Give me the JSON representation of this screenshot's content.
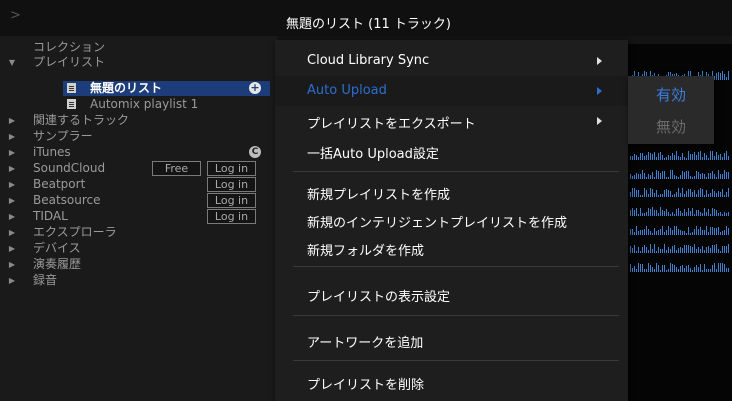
{
  "header": {
    "title": "無題のリスト (11 トラック)"
  },
  "sidebar": {
    "top_chevron": ">",
    "items": [
      {
        "label": "コレクション",
        "arrow": "none"
      },
      {
        "label": "プレイリスト",
        "arrow": "open"
      },
      {
        "label": "無題のリスト",
        "arrow": "none",
        "selected": true
      },
      {
        "label": "Automix playlist 1",
        "arrow": "none"
      },
      {
        "label": "関連するトラック",
        "arrow": "closed"
      },
      {
        "label": "サンプラー",
        "arrow": "closed"
      },
      {
        "label": "iTunes",
        "arrow": "closed"
      },
      {
        "label": "SoundCloud",
        "arrow": "closed",
        "buttons": [
          "Free",
          "Log in"
        ]
      },
      {
        "label": "Beatport",
        "arrow": "closed",
        "buttons": [
          "Log in"
        ]
      },
      {
        "label": "Beatsource",
        "arrow": "closed",
        "buttons": [
          "Log in"
        ]
      },
      {
        "label": "TIDAL",
        "arrow": "closed",
        "buttons": [
          "Log in"
        ]
      },
      {
        "label": "エクスプローラ",
        "arrow": "closed"
      },
      {
        "label": "デバイス",
        "arrow": "closed"
      },
      {
        "label": "演奏履歴",
        "arrow": "closed"
      },
      {
        "label": "録音",
        "arrow": "closed"
      }
    ],
    "plus_icon": "+",
    "sync_icon": "C"
  },
  "context_menu": {
    "items": [
      {
        "label": "Cloud Library Sync",
        "submenu": true
      },
      {
        "label": "Auto Upload",
        "submenu": true,
        "highlighted": true
      },
      {
        "label": "プレイリストをエクスポート",
        "submenu": true
      },
      {
        "label": "一括Auto Upload設定"
      },
      {
        "label": "新規プレイリストを作成"
      },
      {
        "label": "新規のインテリジェントプレイリストを作成"
      },
      {
        "label": "新規フォルダを作成"
      },
      {
        "label": "プレイリストの表示設定"
      },
      {
        "label": "アートワークを追加"
      },
      {
        "label": "プレイリストを削除"
      }
    ]
  },
  "submenu": {
    "on": "有効",
    "off": "無効"
  },
  "colors": {
    "accent": "#2b6fd1",
    "selection": "#1c3d7a",
    "waveform": "#3f7fd0"
  }
}
